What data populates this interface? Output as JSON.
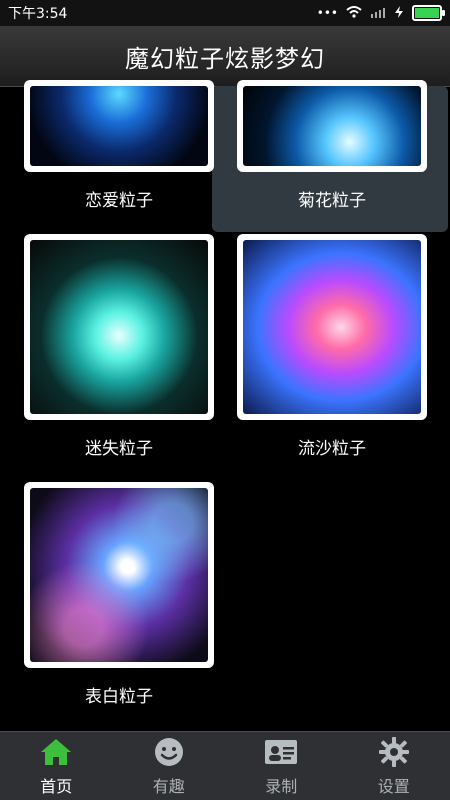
{
  "status": {
    "time": "下午3:54",
    "dots": "•••"
  },
  "app": {
    "title": "魔幻粒子炫影梦幻"
  },
  "cards": [
    {
      "label": "恋爱粒子"
    },
    {
      "label": "菊花粒子"
    },
    {
      "label": "迷失粒子"
    },
    {
      "label": "流沙粒子"
    },
    {
      "label": "表白粒子"
    }
  ],
  "nav": [
    {
      "label": "首页",
      "icon": "home-icon",
      "active": true
    },
    {
      "label": "有趣",
      "icon": "smile-icon"
    },
    {
      "label": "录制",
      "icon": "id-card-icon"
    },
    {
      "label": "设置",
      "icon": "gear-icon"
    }
  ],
  "colors": {
    "accent_green": "#3dbf3d",
    "nav_bg": "#2e3033"
  }
}
